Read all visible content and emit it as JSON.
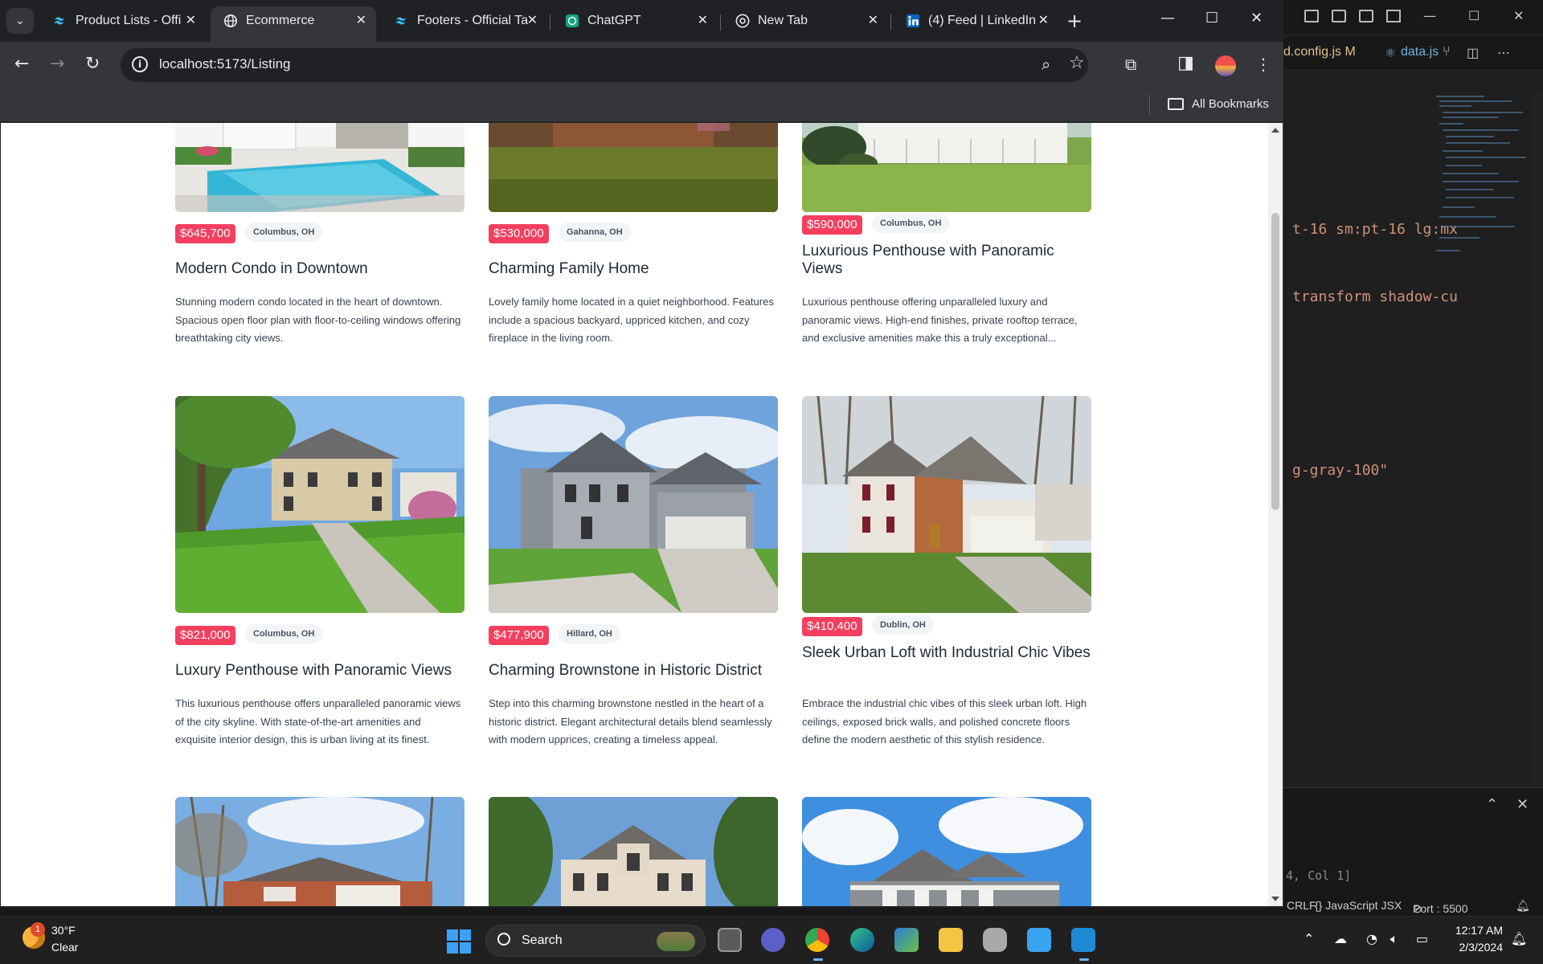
{
  "browser": {
    "tabs": [
      {
        "title": "Product Lists - Offi",
        "favicon": "tailwind-icon",
        "active": false
      },
      {
        "title": "Ecommerce",
        "favicon": "globe-icon",
        "active": true
      },
      {
        "title": "Footers - Official Ta",
        "favicon": "tailwind-icon",
        "active": false
      },
      {
        "title": "ChatGPT",
        "favicon": "chatgpt-icon",
        "active": false
      },
      {
        "title": "New Tab",
        "favicon": "chrome-icon",
        "active": false
      },
      {
        "title": "(4) Feed | LinkedIn",
        "favicon": "linkedin-icon",
        "active": false
      }
    ],
    "url": "localhost:5173/Listing",
    "bookmarks_label": "All Bookmarks"
  },
  "listings": [
    {
      "price": "$645,700",
      "location": "Columbus, OH",
      "title": "Modern Condo in Downtown",
      "description": "Stunning modern condo located in the heart of downtown. Spacious open floor plan with floor-to-ceiling windows offering breathtaking city views."
    },
    {
      "price": "$530,000",
      "location": "Gahanna, OH",
      "title": "Charming Family Home",
      "description": "Lovely family home located in a quiet neighborhood. Features include a spacious backyard, uppriced kitchen, and cozy fireplace in the living room."
    },
    {
      "price": "$590,000",
      "location": "Columbus, OH",
      "title": "Luxurious Penthouse with Panoramic Views",
      "description": "Luxurious penthouse offering unparalleled luxury and panoramic views. High-end finishes, private rooftop terrace, and exclusive amenities make this a truly exceptional..."
    },
    {
      "price": "$821,000",
      "location": "Columbus, OH",
      "title": "Luxury Penthouse with Panoramic Views",
      "description": "This luxurious penthouse offers unparalleled panoramic views of the city skyline. With state-of-the-art amenities and exquisite interior design, this is urban living at its finest."
    },
    {
      "price": "$477,900",
      "location": "Hillard, OH",
      "title": "Charming Brownstone in Historic District",
      "description": "Step into this charming brownstone nestled in the heart of a historic district. Elegant architectural details blend seamlessly with modern upprices, creating a timeless appeal."
    },
    {
      "price": "$410,400",
      "location": "Dublin, OH",
      "title": "Sleek Urban Loft with Industrial Chic Vibes",
      "description": "Embrace the industrial chic vibes of this sleek urban loft. High ceilings, exposed brick walls, and polished concrete floors define the modern aesthetic of this stylish residence."
    }
  ],
  "editor": {
    "tab1": "d.config.js",
    "tab1_badge": "M",
    "tab2": "data.js",
    "code_lines": [
      "t-16 sm:pt-16 lg:mx",
      "transform shadow-cu",
      "g-gray-100\""
    ],
    "cursor_pos": "4, Col 1]"
  },
  "statusbar": {
    "lang": "{} JavaScript JSX",
    "port": "Port : 5500",
    "eol": "CRLF"
  },
  "taskbar": {
    "weather_temp": "30°F",
    "weather_cond": "Clear",
    "weather_badge": "1",
    "search_label": "Search",
    "time": "12:17 AM",
    "date": "2/3/2024"
  },
  "colors": {
    "price_badge": "#f43f5e",
    "chrome_dark": "#202124",
    "chrome_toolbar": "#35363a"
  }
}
